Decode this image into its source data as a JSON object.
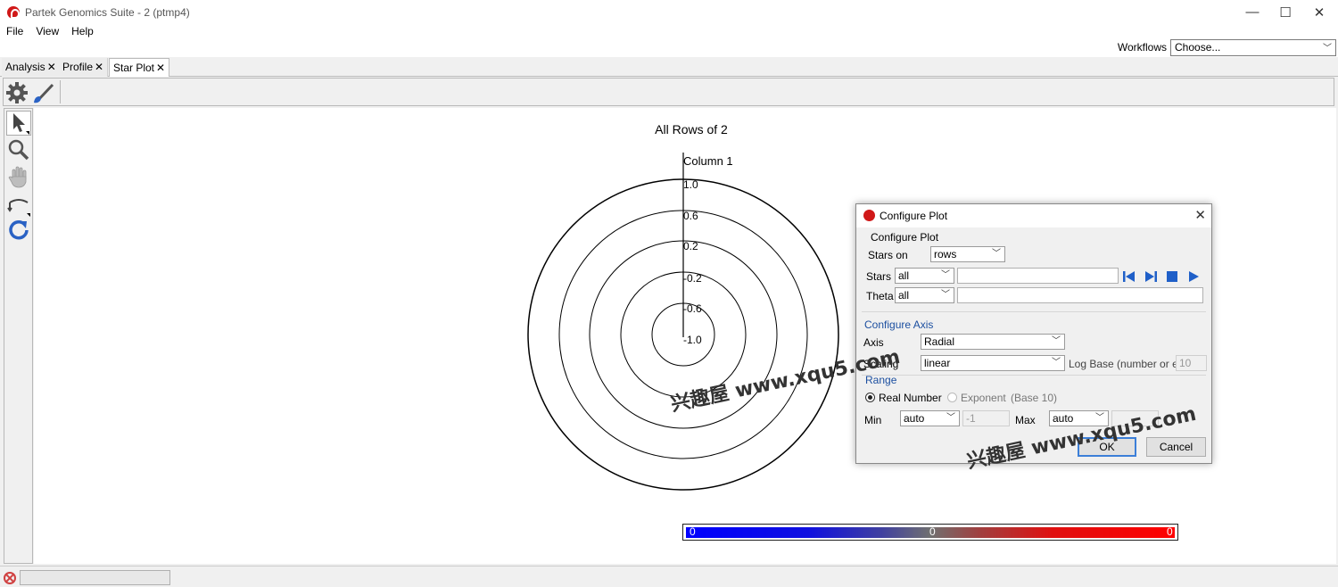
{
  "window": {
    "title": "Partek Genomics Suite - 2 (ptmp4)",
    "controls": {
      "minimize": "—",
      "maximize": "☐",
      "close": "✕"
    }
  },
  "menu": [
    "File",
    "View",
    "Help"
  ],
  "workflows": {
    "label": "Workflows",
    "value": "Choose..."
  },
  "tabs": [
    {
      "label": "Analysis",
      "close": "✕"
    },
    {
      "label": "Profile",
      "close": "✕"
    },
    {
      "label": "Star Plot",
      "close": "✕"
    }
  ],
  "toolbar": {
    "icons": [
      "gear-icon",
      "paintbrush-icon"
    ]
  },
  "sidebar": {
    "tools": [
      "pointer-icon",
      "zoom-icon",
      "hand-icon",
      "rotate-icon",
      "reset-icon"
    ]
  },
  "plot": {
    "title": "All Rows of 2",
    "axis_label": "Column 1",
    "radial_ticks": [
      "1.0",
      "0.6",
      "0.2",
      "-0.2",
      "-0.6",
      "-1.0"
    ],
    "colorbar": {
      "left": "0",
      "mid": "0",
      "right": "0"
    }
  },
  "dialog": {
    "title": "Configure Plot",
    "section_label": "Configure Plot",
    "stars_on": {
      "label": "Stars on",
      "value": "rows"
    },
    "stars": {
      "label": "Stars",
      "value": "all",
      "text": ""
    },
    "theta": {
      "label": "Theta",
      "value": "all",
      "text": ""
    },
    "configure_axis": "Configure Axis",
    "axis": {
      "label": "Axis",
      "value": "Radial"
    },
    "scaling": {
      "label": "Scaling",
      "value": "linear",
      "log_base_label": "Log Base (number or e)",
      "log_base_value": "10"
    },
    "range_label": "Range",
    "real_number": "Real Number",
    "exponent": "Exponent",
    "base_note": "(Base 10)",
    "min": {
      "label": "Min",
      "value": "auto",
      "text": "-1"
    },
    "max": {
      "label": "Max",
      "value": "auto"
    },
    "ok": "OK",
    "cancel": "Cancel"
  },
  "watermarks": [
    "兴趣屋 www.xqu5.com",
    "兴趣屋 www.xqu5.com"
  ]
}
